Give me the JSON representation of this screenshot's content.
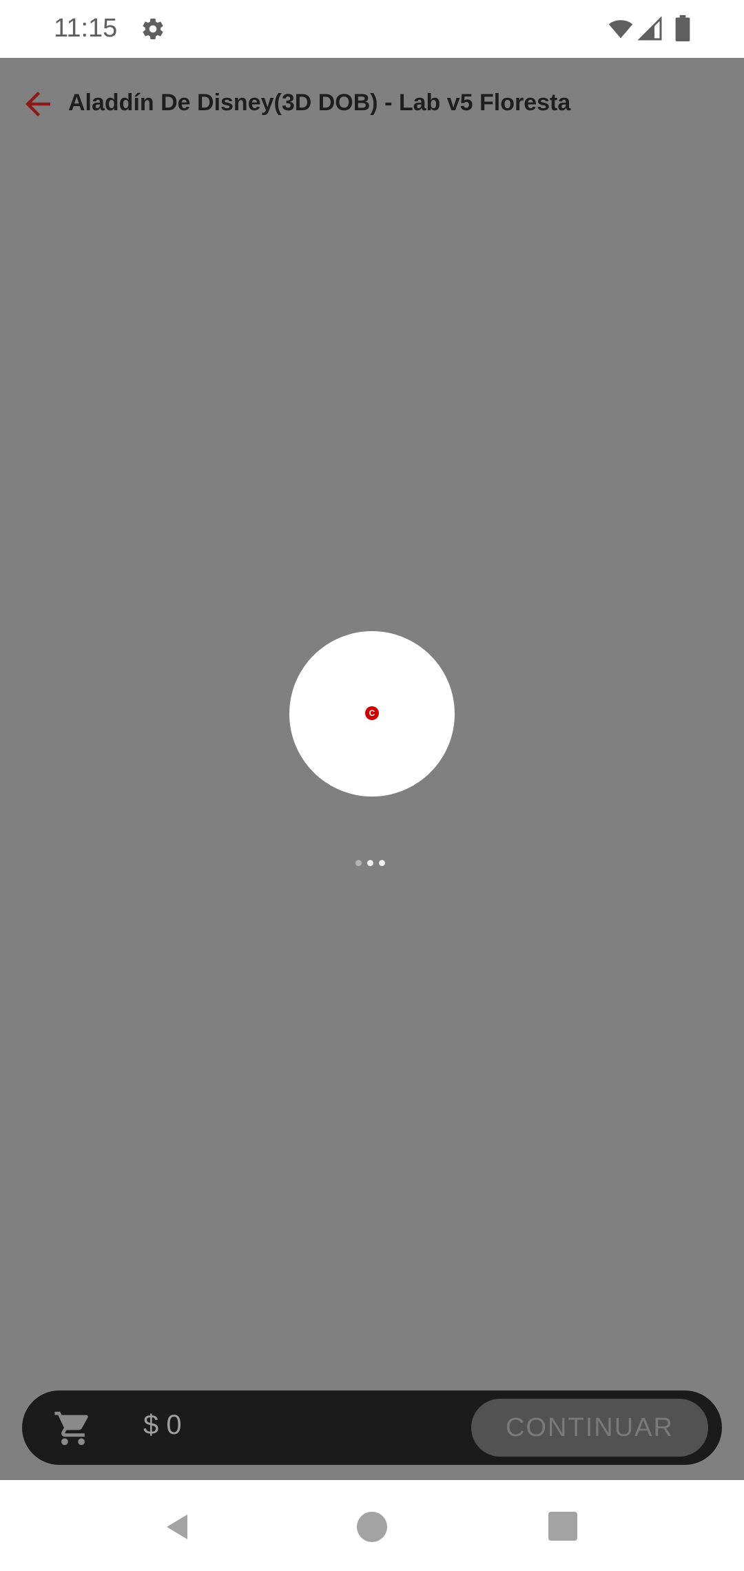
{
  "status_bar": {
    "time": "11:15",
    "icons": [
      "gear-icon",
      "wifi-icon",
      "signal-icon",
      "battery-icon"
    ]
  },
  "header": {
    "title": "Aladdín De Disney(3D DOB) - Lab v5 Floresta",
    "back_icon": "arrow-back-icon"
  },
  "loader": {
    "logo_letter": "C",
    "dots": 3
  },
  "cart": {
    "icon": "cart-icon",
    "total": "$ 0",
    "continue_label": "CONTINUAR"
  },
  "nav": {
    "icons": [
      "nav-back-icon",
      "nav-home-icon",
      "nav-recent-icon"
    ]
  },
  "colors": {
    "accent": "#8b1a1a",
    "overlay": "#808080",
    "cart_bar": "#1b1b1b",
    "logo_red": "#cc0000"
  }
}
